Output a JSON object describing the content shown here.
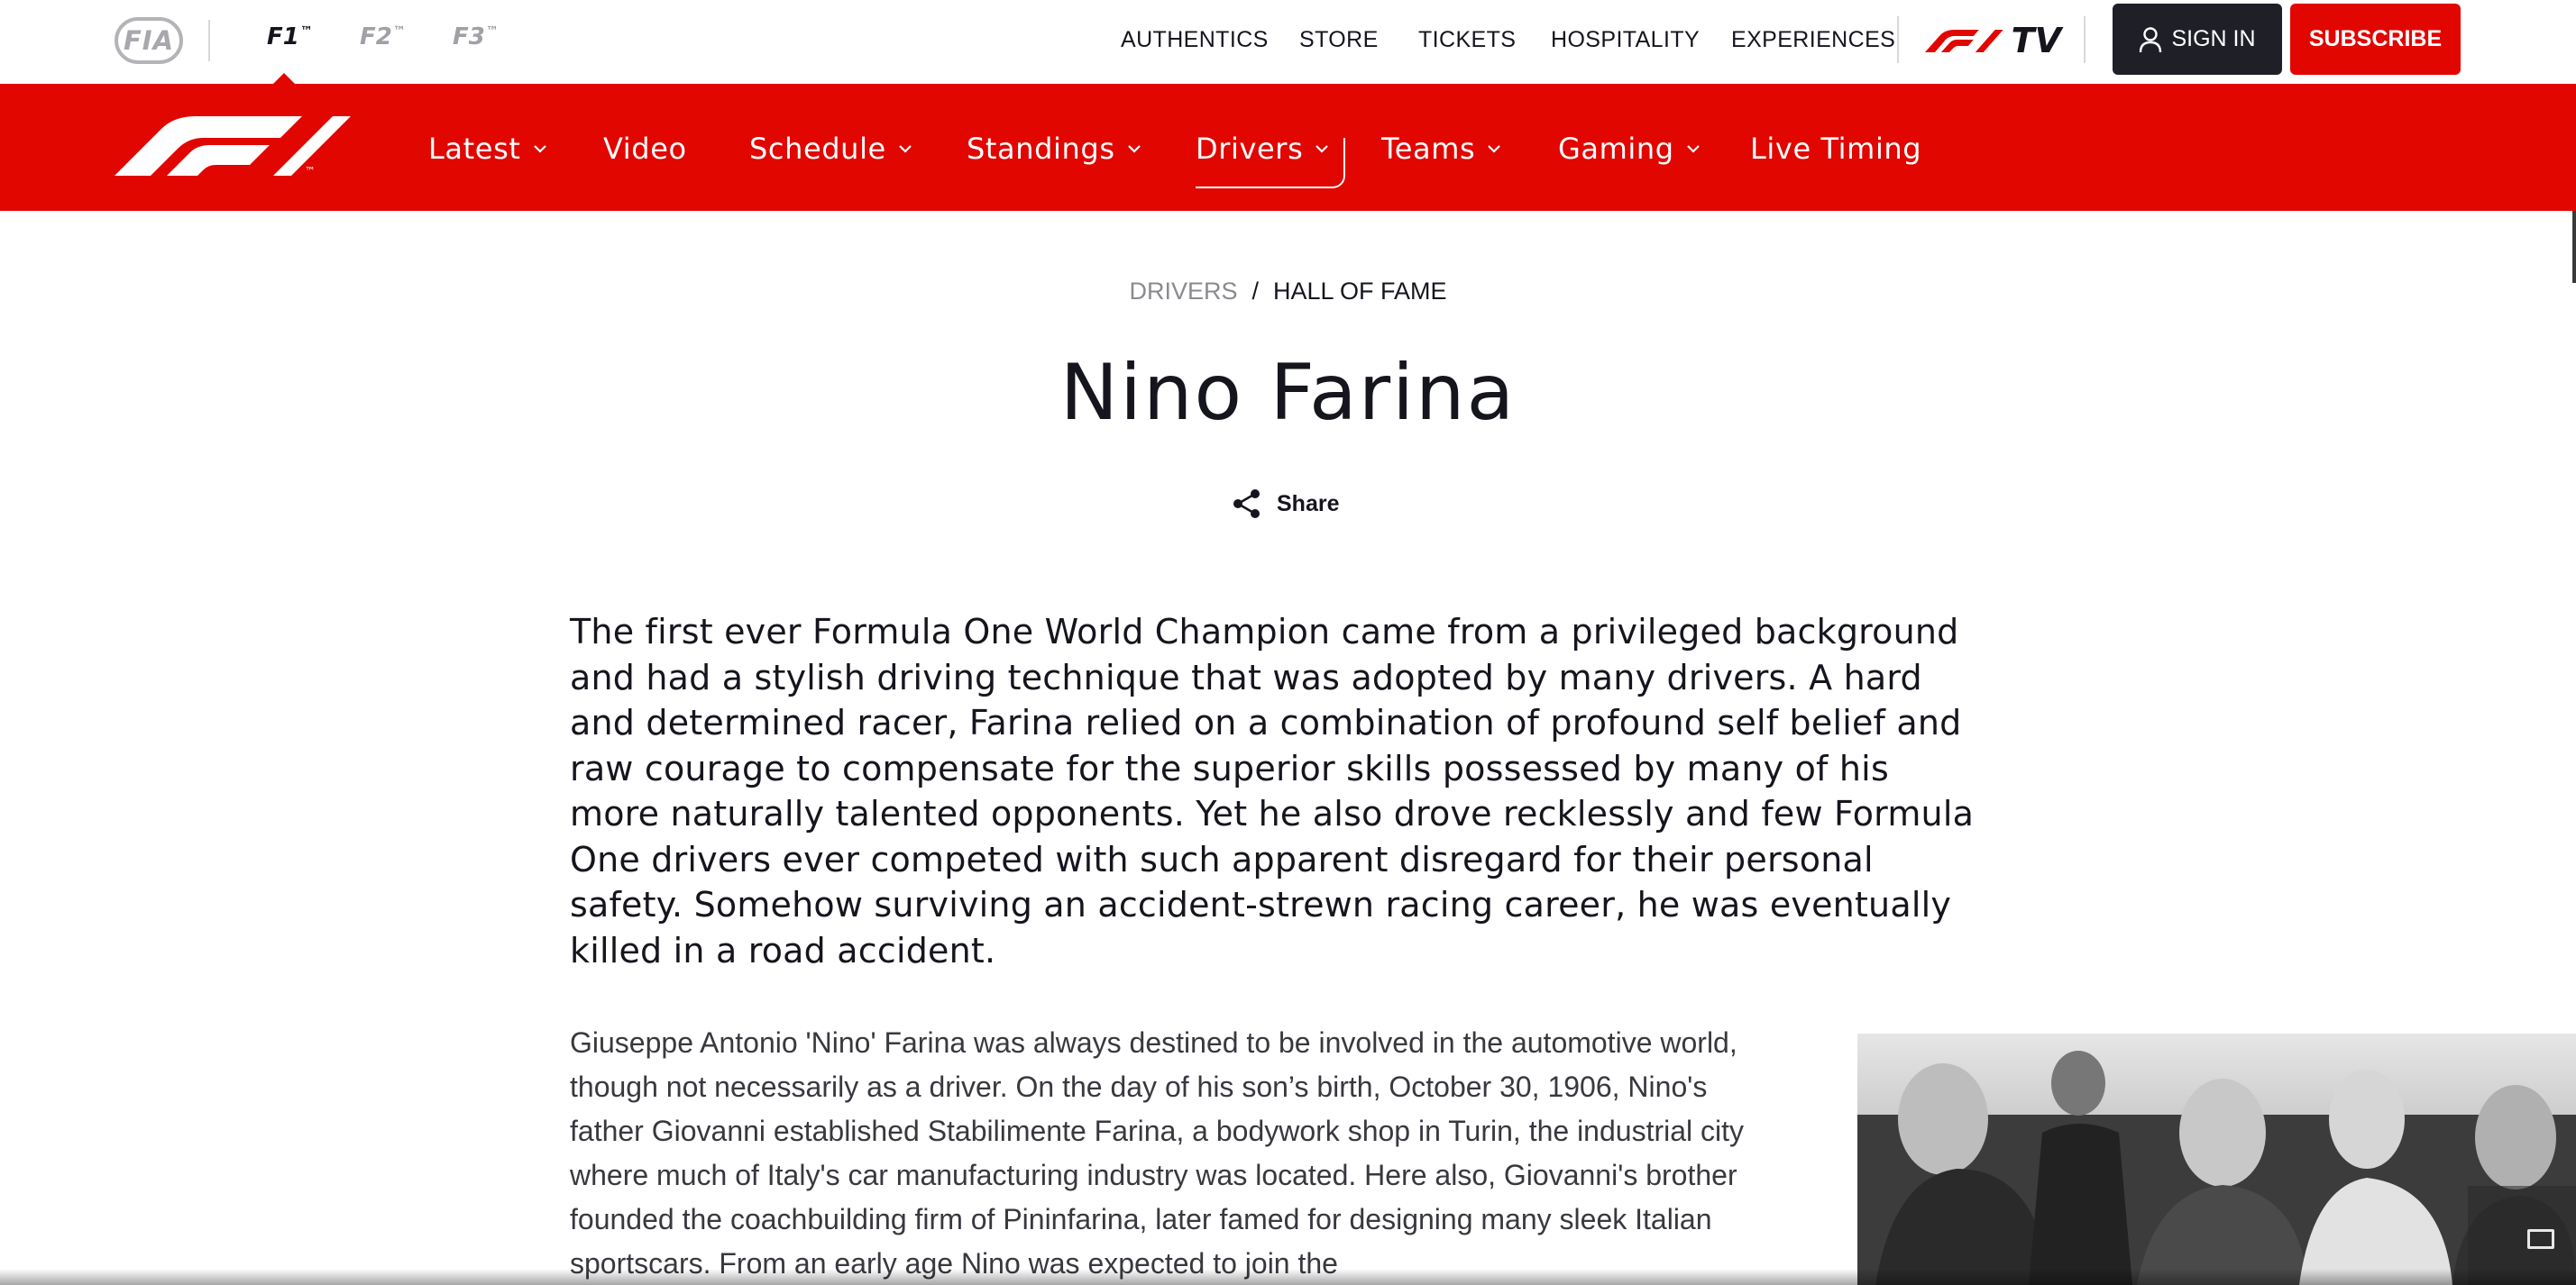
{
  "topbar": {
    "fia_label": "FIA",
    "series": [
      {
        "label": "F1",
        "tm": "™"
      },
      {
        "label": "F2",
        "tm": "™"
      },
      {
        "label": "F3",
        "tm": "™"
      }
    ],
    "links": [
      "AUTHENTICS",
      "STORE",
      "TICKETS",
      "HOSPITALITY",
      "EXPERIENCES"
    ],
    "f1tv_label": "TV",
    "signin_label": "SIGN IN",
    "subscribe_label": "SUBSCRIBE"
  },
  "nav": {
    "logo_tm": "™",
    "items": [
      {
        "label": "Latest",
        "dropdown": true
      },
      {
        "label": "Video",
        "dropdown": false
      },
      {
        "label": "Schedule",
        "dropdown": true
      },
      {
        "label": "Standings",
        "dropdown": true
      },
      {
        "label": "Drivers",
        "dropdown": true,
        "active": true
      },
      {
        "label": "Teams",
        "dropdown": true
      },
      {
        "label": "Gaming",
        "dropdown": true
      },
      {
        "label": "Live Timing",
        "dropdown": false
      }
    ]
  },
  "breadcrumb": {
    "parent": "DRIVERS",
    "separator": "/",
    "current": "HALL OF FAME"
  },
  "title": "Nino Farina",
  "share_label": "Share",
  "lead_text": "The first ever Formula One World Champion came from a privileged background and had a stylish driving technique that was adopted by many drivers. A hard and determined racer, Farina relied on a combination of profound self belief and raw courage to compensate for the superior skills possessed by many of his more naturally talented opponents. Yet he also drove recklessly and few Formula One drivers ever competed with such apparent disregard for their personal safety. Somehow surviving an accident-strewn racing career, he was eventually killed in a road accident.",
  "body_text": "Giuseppe Antonio 'Nino' Farina was always destined to be involved in the automotive world, though not necessarily as a driver. On the day of his son’s birth, October 30, 1906, Nino's father Giovanni established Stabilimente Farina, a bodywork shop in Turin, the industrial city where much of Italy's car manufacturing industry was located. Here also, Giovanni's brother founded the coachbuilding firm of Pininfarina, later famed for designing many sleek Italian sportscars. From an early age Nino was expected to join the",
  "colors": {
    "brand_red": "#e10600",
    "dark": "#15151e",
    "signin_bg": "#1f1f27"
  }
}
